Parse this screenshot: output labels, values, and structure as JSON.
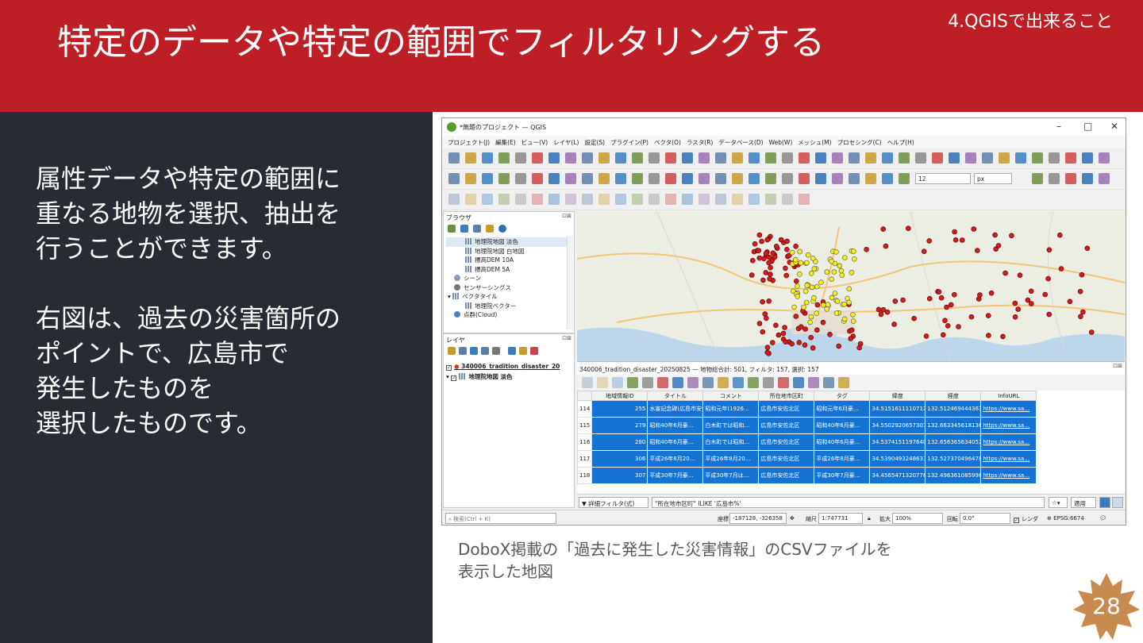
{
  "slide": {
    "title": "特定のデータや特定の範囲でフィルタリングする",
    "section": "4.QGISで出来ること",
    "body_lines": [
      "属性データや特定の範囲に",
      "重なる地物を選択、抽出を",
      "行うことができます。",
      "",
      "右図は、過去の災害箇所の",
      "ポイントで、広島市で",
      "発生したものを",
      "選択したものです。"
    ],
    "caption_lines": [
      "DoboX掲載の「過去に発生した災害情報」のCSVファイルを",
      "表示した地図"
    ],
    "page_number": "28",
    "colors": {
      "header": "#be1e26",
      "left_panel": "#272b32",
      "badge": "#c98a4e",
      "selected_row": "#1573d4"
    }
  },
  "qgis": {
    "window_title": "*無題のプロジェクト — QGIS",
    "menu": [
      "プロジェクト(J)",
      "編集(E)",
      "ビュー(V)",
      "レイヤ(L)",
      "設定(S)",
      "プラグイン(P)",
      "ベクタ(O)",
      "ラスタ(R)",
      "データベース(D)",
      "Web(W)",
      "メッシュ(M)",
      "プロセシング(C)",
      "ヘルプ(H)"
    ],
    "font_size_value": "12",
    "font_unit": "px",
    "browser": {
      "title": "ブラウザ",
      "items": [
        {
          "label": "地理院地図 淡色",
          "selected": true
        },
        {
          "label": "地理院地図 白地図"
        },
        {
          "label": "標高DEM 10A"
        },
        {
          "label": "標高DEM 5A"
        },
        {
          "label": "シーン"
        },
        {
          "label": "センサーシングス"
        },
        {
          "label": "ベクタタイル"
        },
        {
          "label": "地理院ベクター"
        },
        {
          "label": "点群(Cloud)"
        }
      ]
    },
    "layers": {
      "title": "レイヤ",
      "items": [
        {
          "label": "340006_tradition_disaster_20"
        },
        {
          "label": "地理院地図 淡色"
        }
      ]
    },
    "attribute_table": {
      "title": "340006_tradition_disaster_20250825 — 地物総合計: 501, フィルタ: 157, 選択: 157",
      "columns": [
        "地域情報ID",
        "タイトル",
        "コメント",
        "所在地市区町",
        "タグ",
        "緯度",
        "経度",
        "InfoURL"
      ],
      "rows": [
        {
          "n": "114",
          "cells": [
            "255",
            "水害記念碑(広島市安佐北区可部)",
            "昭和元年(1926…",
            "広島市安佐北区",
            "昭和元年6月豪…",
            "34.5151611110712",
            "132.512469444363",
            "https://www.sa…"
          ]
        },
        {
          "n": "115",
          "cells": [
            "279",
            "昭和40年6月豪…",
            "白木町では昭和…",
            "広島市安佐北区",
            "昭和40年6月豪…",
            "34.5502920657307",
            "132.663345618136",
            "https://www.sa…"
          ]
        },
        {
          "n": "116",
          "cells": [
            "280",
            "昭和40年6月豪…",
            "白木町では昭和…",
            "広島市安佐北区",
            "昭和40年6月豪…",
            "34.5374151197640",
            "132.656365634052",
            "https://www.sa…"
          ]
        },
        {
          "n": "117",
          "cells": [
            "306",
            "平成26年8月20…",
            "平成26年8月20…",
            "広島市安佐北区",
            "平成26年8月豪…",
            "34.5390493248631",
            "132.527370496478",
            "https://www.sa…"
          ]
        },
        {
          "n": "118",
          "cells": [
            "307",
            "平成30年7月豪…",
            "平成30年7月は…",
            "広島市安佐北区",
            "平成30年7月豪…",
            "34.4565471320776",
            "132.496361085998",
            "https://www.sa…"
          ]
        }
      ],
      "filter_mode": "詳細フィルタ(式)",
      "filter_expression": "\"所在地市区町\" ILIKE '広島市%'",
      "apply_label": "適用"
    },
    "status": {
      "search_placeholder": "検索(Ctrl + K)",
      "coord_label": "座標",
      "coord_value": "-187128, -326358",
      "scale_label": "縮尺",
      "scale_value": "1:747731",
      "magnify_label": "拡大",
      "magnify_value": "100%",
      "rotation_label": "回転",
      "rotation_value": "0.0°",
      "render_label": "レンダ",
      "crs": "EPSG:6674"
    }
  }
}
